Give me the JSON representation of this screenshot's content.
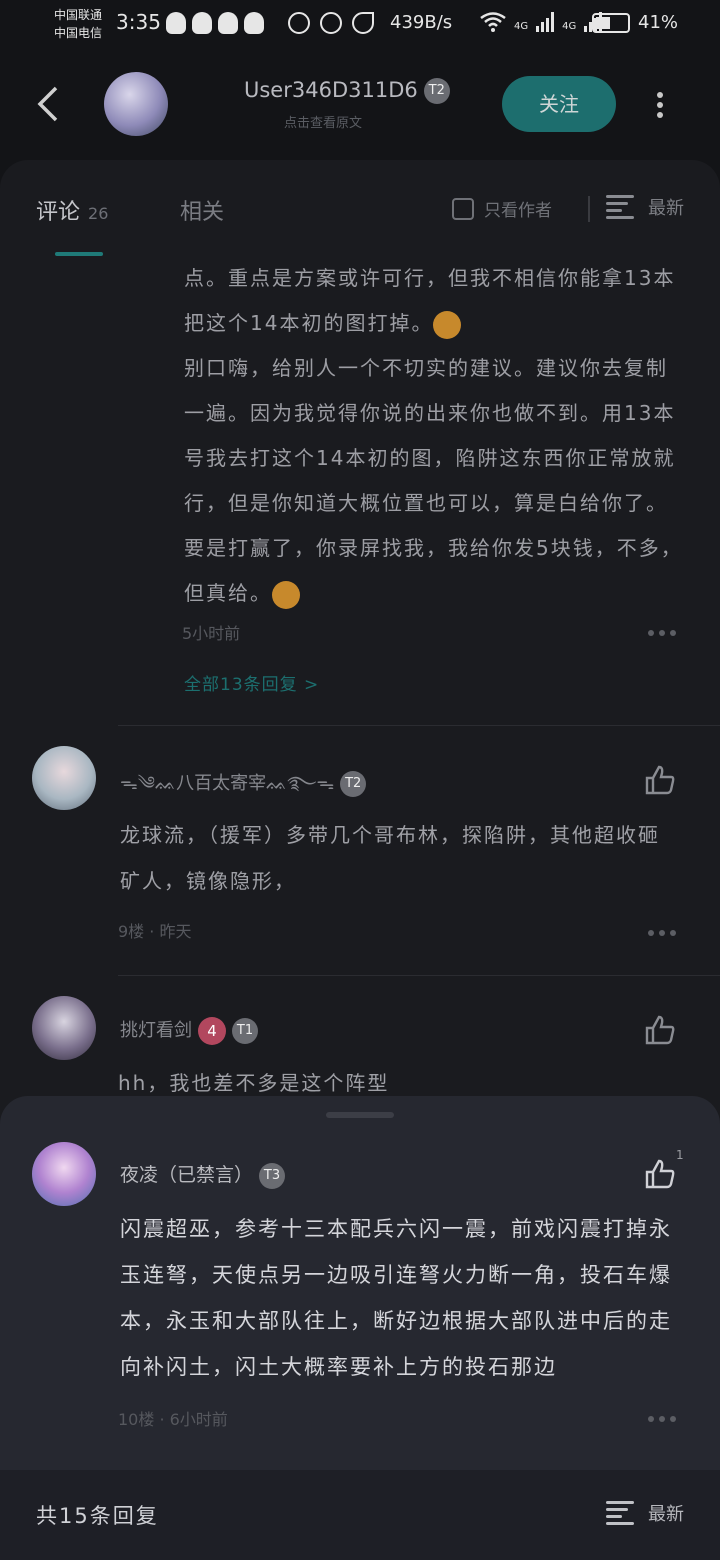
{
  "status_bar": {
    "carrier1": "中国联通",
    "carrier2": "中国电信",
    "time": "3:35",
    "speed": "439B/s",
    "network1": "4G",
    "network2": "4G",
    "battery": "41%"
  },
  "header": {
    "username": "User346D311D6",
    "level": "T2",
    "subtitle": "点击查看原文",
    "follow_label": "关注"
  },
  "tabs": {
    "comments_label": "评论",
    "comments_count": "26",
    "related_label": "相关",
    "only_author_label": "只看作者",
    "sort_label": "最新"
  },
  "reply": {
    "text1": "点。重点是方案或许可行，但我不相信你能拿13本把这个14本初的图打掉。",
    "text2": "别口嗨，给别人一个不切实的建议。建议你去复制一遍。因为我觉得你说的出来你也做不到。用13本号我去打这个14本初的图，陷阱这东西你正常放就行，但是你知道大概位置也可以，算是白给你了。要是打赢了，你录屏找我，我给你发5块钱，不多，但真给。",
    "time": "5小时前",
    "all_replies": "全部13条回复 >"
  },
  "comments": [
    {
      "username": "ᯓ༄ᨐ八百太寄宰ᨐ࿐ᯓ",
      "level": "T2",
      "body": "龙球流，（援军）多带几个哥布林，探陷阱，其他超收砸矿人，镜像隐形，",
      "meta": "9楼 · 昨天"
    },
    {
      "username": "挑灯看剑",
      "badge": "4",
      "level": "T1",
      "body": "hh，我也差不多是这个阵型"
    }
  ],
  "sheet": {
    "username": "夜凌（已禁言）",
    "level": "T3",
    "like_count": "1",
    "body": "闪震超巫，参考十三本配兵六闪一震，前戏闪震打掉永玉连弩，天使点另一边吸引连弩火力断一角，投石车爆本，永玉和大部队往上，断好边根据大部队进中后的走向补闪土，闪土大概率要补上方的投石那边",
    "meta": "10楼 · 6小时前",
    "total_replies": "共15条回复",
    "sort_label": "最新"
  },
  "colors": {
    "accent": "#1d6e6e",
    "background": "#131417",
    "panel": "#1a1b1f",
    "sheet": "#262830"
  }
}
